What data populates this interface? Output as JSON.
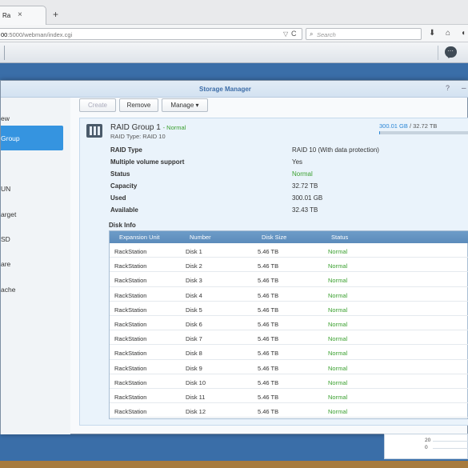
{
  "browser": {
    "tab_title": "Ra",
    "tab_close": "×",
    "new_tab": "+",
    "url_host": "00",
    "url_path": ":5000/webman/index.cgi",
    "url_dropdown": "▽",
    "url_reload": "C",
    "search_placeholder": "Search",
    "nav_icons": [
      "download-icon",
      "home-icon",
      "shield-icon",
      "menu-icon"
    ]
  },
  "window": {
    "title": "Storage Manager",
    "help": "?",
    "minimize": "–"
  },
  "sidebar": {
    "items": [
      {
        "label": "ew"
      },
      {
        "label": "Group",
        "active": true
      },
      {
        "label": ""
      },
      {
        "label": "UN"
      },
      {
        "label": "arget"
      },
      {
        "label": "SD"
      },
      {
        "label": "are"
      },
      {
        "label": "ache"
      }
    ]
  },
  "toolbar": {
    "create": "Create",
    "remove": "Remove",
    "manage": "Manage ▾"
  },
  "raid": {
    "title": "RAID Group 1",
    "status_inline": "- Normal",
    "subtitle": "RAID Type: RAID 10",
    "used": "300.01 GB",
    "total": "/ 32.72 TB",
    "usage_fraction": 0.009,
    "fields": [
      {
        "label": "RAID Type",
        "value": "RAID 10 (With data protection)"
      },
      {
        "label": "Multiple volume support",
        "value": "Yes"
      },
      {
        "label": "Status",
        "value": "Normal",
        "ok": true
      },
      {
        "label": "Capacity",
        "value": "32.72 TB"
      },
      {
        "label": "Used",
        "value": "300.01 GB"
      },
      {
        "label": "Available",
        "value": "32.43 TB"
      }
    ]
  },
  "disk_info": {
    "title": "Disk Info",
    "columns": [
      "Expansion Unit",
      "Number",
      "Disk Size",
      "Status"
    ],
    "rows": [
      [
        "RackStation",
        "Disk 1",
        "5.46 TB",
        "Normal"
      ],
      [
        "RackStation",
        "Disk 2",
        "5.46 TB",
        "Normal"
      ],
      [
        "RackStation",
        "Disk 3",
        "5.46 TB",
        "Normal"
      ],
      [
        "RackStation",
        "Disk 4",
        "5.46 TB",
        "Normal"
      ],
      [
        "RackStation",
        "Disk 5",
        "5.46 TB",
        "Normal"
      ],
      [
        "RackStation",
        "Disk 6",
        "5.46 TB",
        "Normal"
      ],
      [
        "RackStation",
        "Disk 7",
        "5.46 TB",
        "Normal"
      ],
      [
        "RackStation",
        "Disk 8",
        "5.46 TB",
        "Normal"
      ],
      [
        "RackStation",
        "Disk 9",
        "5.46 TB",
        "Normal"
      ],
      [
        "RackStation",
        "Disk 10",
        "5.46 TB",
        "Normal"
      ],
      [
        "RackStation",
        "Disk 11",
        "5.46 TB",
        "Normal"
      ],
      [
        "RackStation",
        "Disk 12",
        "5.46 TB",
        "Normal"
      ]
    ]
  },
  "widget": {
    "axis_labels": [
      "20",
      "0"
    ]
  },
  "colors": {
    "accent": "#3594e0",
    "normal_status": "#3aa02f",
    "table_header": "#6d9cc8"
  }
}
